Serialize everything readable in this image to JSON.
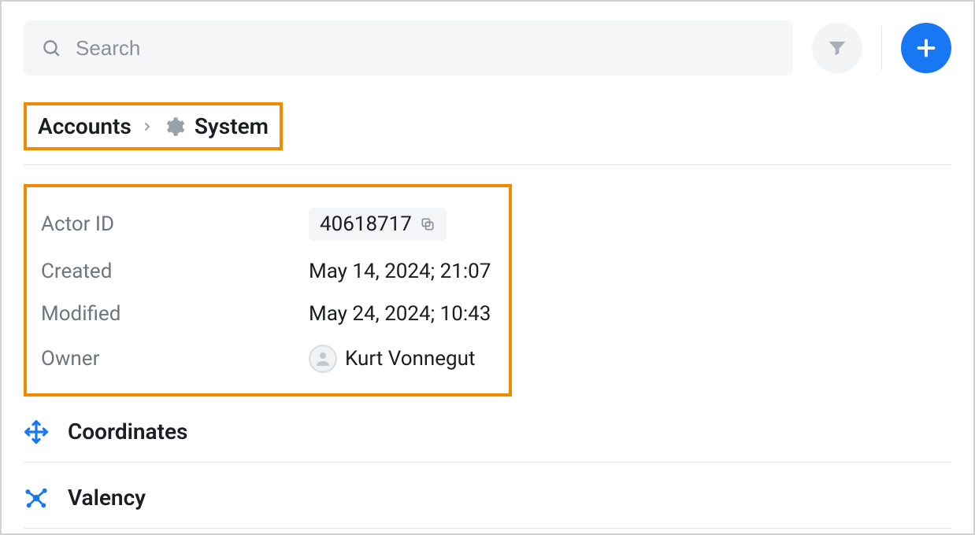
{
  "search": {
    "placeholder": "Search"
  },
  "breadcrumb": {
    "root": "Accounts",
    "current": "System"
  },
  "details": {
    "actor_id_label": "Actor ID",
    "actor_id_value": "40618717",
    "created_label": "Created",
    "created_value": "May 14, 2024; 21:07",
    "modified_label": "Modified",
    "modified_value": "May 24, 2024; 10:43",
    "owner_label": "Owner",
    "owner_value": "Kurt Vonnegut"
  },
  "sections": {
    "coordinates": "Coordinates",
    "valency": "Valency"
  }
}
